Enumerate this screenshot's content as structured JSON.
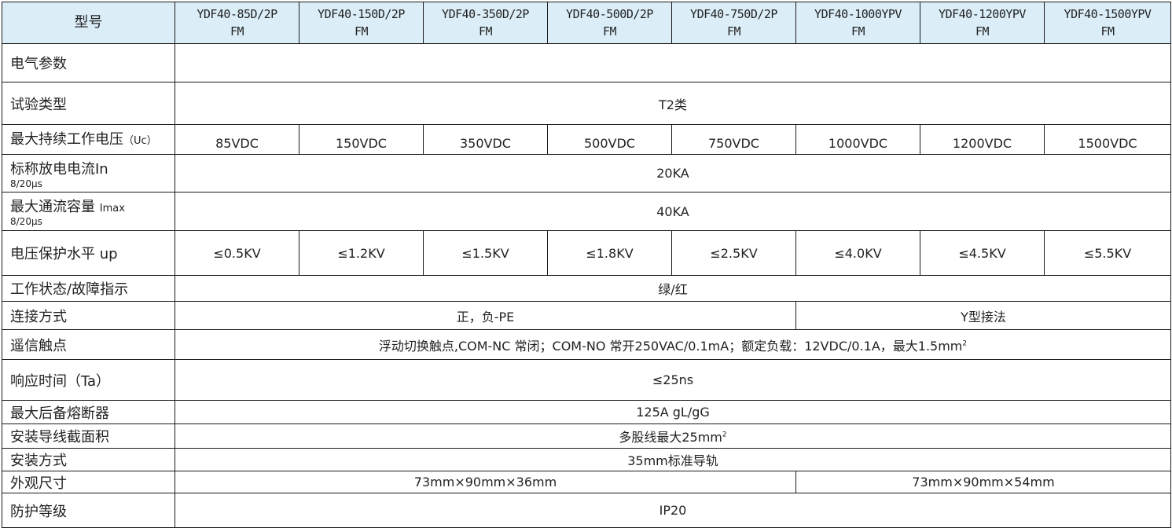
{
  "header": {
    "model_label": "型号",
    "models": [
      [
        "YDF40-85D/2P",
        "FM"
      ],
      [
        "YDF40-150D/2P",
        "FM"
      ],
      [
        "YDF40-350D/2P",
        "FM"
      ],
      [
        "YDF40-500D/2P",
        "FM"
      ],
      [
        "YDF40-750D/2P",
        "FM"
      ],
      [
        "YDF40-1000YPV",
        "FM"
      ],
      [
        "YDF40-1200YPV",
        "FM"
      ],
      [
        "YDF40-1500YPV",
        "FM"
      ]
    ]
  },
  "rows": {
    "electrical": {
      "label": "电气参数"
    },
    "test_type": {
      "label": "试验类型",
      "value": "T2类"
    },
    "uc": {
      "label": "最大持续工作电压",
      "label_suffix": "（Uc）",
      "values": [
        "85VDC",
        "150VDC",
        "350VDC",
        "500VDC",
        "750VDC",
        "1000VDC",
        "1200VDC",
        "1500VDC"
      ]
    },
    "in": {
      "label": "标称放电电流In",
      "sub": "8/20μs",
      "value": "20KA"
    },
    "imax": {
      "label": "最大通流容量",
      "label_suffix": "Imax",
      "sub": "8/20μs",
      "value": "40KA"
    },
    "up": {
      "label": "电压保护水平 up",
      "values": [
        "≤0.5KV",
        "≤1.2KV",
        "≤1.5KV",
        "≤1.8KV",
        "≤2.5KV",
        "≤4.0KV",
        "≤4.5KV",
        "≤5.5KV"
      ]
    },
    "indicator": {
      "label": "工作状态/故障指示",
      "value": "绿/红"
    },
    "connection": {
      "label": "连接方式",
      "value_left": "正，负-PE",
      "value_right": "Y型接法"
    },
    "remote": {
      "label": "遥信触点",
      "value": "浮动切换触点,COM-NC 常闭；COM-NO 常开250VAC/0.1mA；额定负载：12VDC/0.1A，最大1.5mm",
      "value_sup": "2"
    },
    "response": {
      "label": "响应时间（Ta）",
      "value": "≤25ns"
    },
    "fuse": {
      "label": "最大后备熔断器",
      "value": "125A gL/gG"
    },
    "wire": {
      "label": "安装导线截面积",
      "value": "多股线最大25mm",
      "value_sup": "2"
    },
    "mounting": {
      "label": "安装方式",
      "value": "35mm标准导轨"
    },
    "dimensions": {
      "label": "外观尺寸",
      "value_left": "73mm×90mm×36mm",
      "value_right": "73mm×90mm×54mm"
    },
    "protection": {
      "label": "防护等级",
      "value": "IP20"
    }
  }
}
